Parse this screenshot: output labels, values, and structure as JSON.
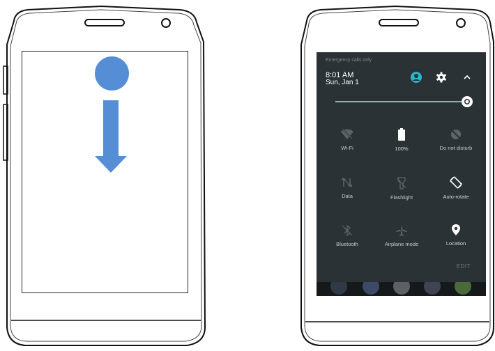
{
  "left_phone": {
    "instruction_shapes": [
      "dot",
      "down-arrow"
    ],
    "accent_color": "#558ed5"
  },
  "quick_settings": {
    "emergency_text": "Emergency calls only",
    "time": "8:01 AM",
    "date": "Sun, Jan 1",
    "icons": [
      "account-icon",
      "settings-gear-icon",
      "collapse-chevron-icon",
      "brightness-icon"
    ],
    "brightness_level": 1.0,
    "accent_color": "#29b6c8",
    "tiles": [
      {
        "label": "Wi-Fi",
        "icon": "wifi-off-icon",
        "active": false
      },
      {
        "label": "100%",
        "icon": "battery-icon",
        "active": true
      },
      {
        "label": "Do not disturb",
        "icon": "dnd-off-icon",
        "active": false
      },
      {
        "label": "Data",
        "icon": "data-off-icon",
        "active": false
      },
      {
        "label": "Flashlight",
        "icon": "flashlight-off-icon",
        "active": false
      },
      {
        "label": "Auto-rotate",
        "icon": "auto-rotate-icon",
        "active": true
      },
      {
        "label": "Bluetooth",
        "icon": "bluetooth-off-icon",
        "active": false
      },
      {
        "label": "Airplane mode",
        "icon": "airplane-off-icon",
        "active": false
      },
      {
        "label": "Location",
        "icon": "location-icon",
        "active": true
      }
    ],
    "edit_label": "EDIT"
  }
}
